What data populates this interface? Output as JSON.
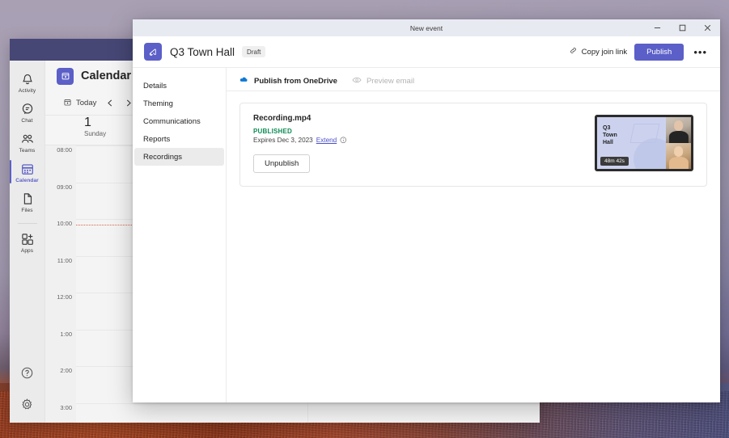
{
  "teams_window": {
    "rail": {
      "items": [
        {
          "label": "Activity",
          "icon": "bell-icon"
        },
        {
          "label": "Chat",
          "icon": "chat-icon"
        },
        {
          "label": "Teams",
          "icon": "teams-icon"
        },
        {
          "label": "Calendar",
          "icon": "calendar-icon"
        },
        {
          "label": "Files",
          "icon": "files-icon"
        },
        {
          "label": "Apps",
          "icon": "apps-icon"
        }
      ],
      "bottom": [
        {
          "label": "Help",
          "icon": "help-icon"
        },
        {
          "label": "Settings",
          "icon": "gear-icon"
        }
      ]
    },
    "calendar": {
      "title": "Calendar",
      "today_label": "Today",
      "prev_label": "‹",
      "next_label": "›",
      "day_number": "1",
      "day_name": "Sunday",
      "time_slots": [
        "08:00",
        "09:00",
        "10:00",
        "11:00",
        "12:00",
        "1:00",
        "2:00",
        "3:00"
      ]
    }
  },
  "dialog": {
    "window_title": "New event",
    "window_controls": {
      "minimize": "minimize-icon",
      "maximize": "maximize-icon",
      "close": "close-icon"
    },
    "header": {
      "event_icon": "megaphone-icon",
      "event_title": "Q3 Town Hall",
      "status_badge": "Draft",
      "copy_join_link": "Copy join link",
      "publish_label": "Publish",
      "more_label": "•••"
    },
    "nav": {
      "items": [
        {
          "label": "Details",
          "active": false
        },
        {
          "label": "Theming",
          "active": false
        },
        {
          "label": "Communications",
          "active": false
        },
        {
          "label": "Reports",
          "active": false
        },
        {
          "label": "Recordings",
          "active": true
        }
      ]
    },
    "tabs": [
      {
        "label": "Publish from OneDrive",
        "icon": "onedrive-cloud-icon",
        "state": "active"
      },
      {
        "label": "Preview email",
        "icon": "eye-icon",
        "state": "disabled"
      }
    ],
    "recording_card": {
      "file_name": "Recording.mp4",
      "status": "PUBLISHED",
      "expiry_text": "Expires Dec 3, 2023",
      "extend_label": "Extend",
      "info_icon": "info-icon",
      "action_label": "Unpublish",
      "thumbnail": {
        "slide_text": "Q3\nTown\nHall",
        "duration": "48m 42s"
      }
    }
  },
  "colors": {
    "brand_purple": "#5b5fc7",
    "teams_titlebar": "#464775",
    "published_green": "#0e8a55",
    "link_blue": "#4a51c7"
  }
}
